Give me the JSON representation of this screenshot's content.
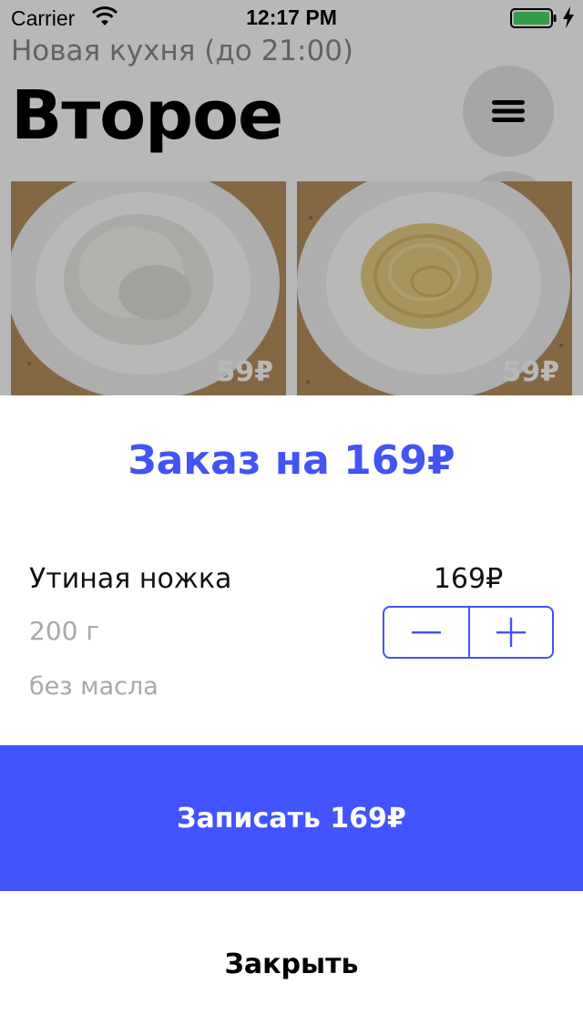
{
  "status_bar": {
    "carrier": "Carrier",
    "time": "12:17 PM",
    "wifi_icon": "wifi-icon",
    "battery_icon": "battery-icon",
    "battery_color": "#4cd964"
  },
  "menu": {
    "subtitle": "Новая кухня (до 21:00)",
    "section_title": "Второе",
    "menu_button_icon": "hamburger-icon",
    "instagram_button_icon": "camera-icon",
    "dishes": [
      {
        "price": "59₽",
        "image": "rice-plate"
      },
      {
        "price": "59₽",
        "image": "spaghetti-plate"
      }
    ]
  },
  "order": {
    "title": "Заказ на 169₽",
    "item": {
      "name": "Утиная ножка",
      "price": "169₽",
      "weight": "200 г",
      "note": "без масла"
    },
    "stepper": {
      "minus_icon": "minus-icon",
      "plus_icon": "plus-icon"
    },
    "submit_label": "Записать 169₽",
    "close_label": "Закрыть"
  },
  "colors": {
    "accent": "#4254f4",
    "button_bg": "#4254ff",
    "muted_text": "#a8a8a8"
  }
}
